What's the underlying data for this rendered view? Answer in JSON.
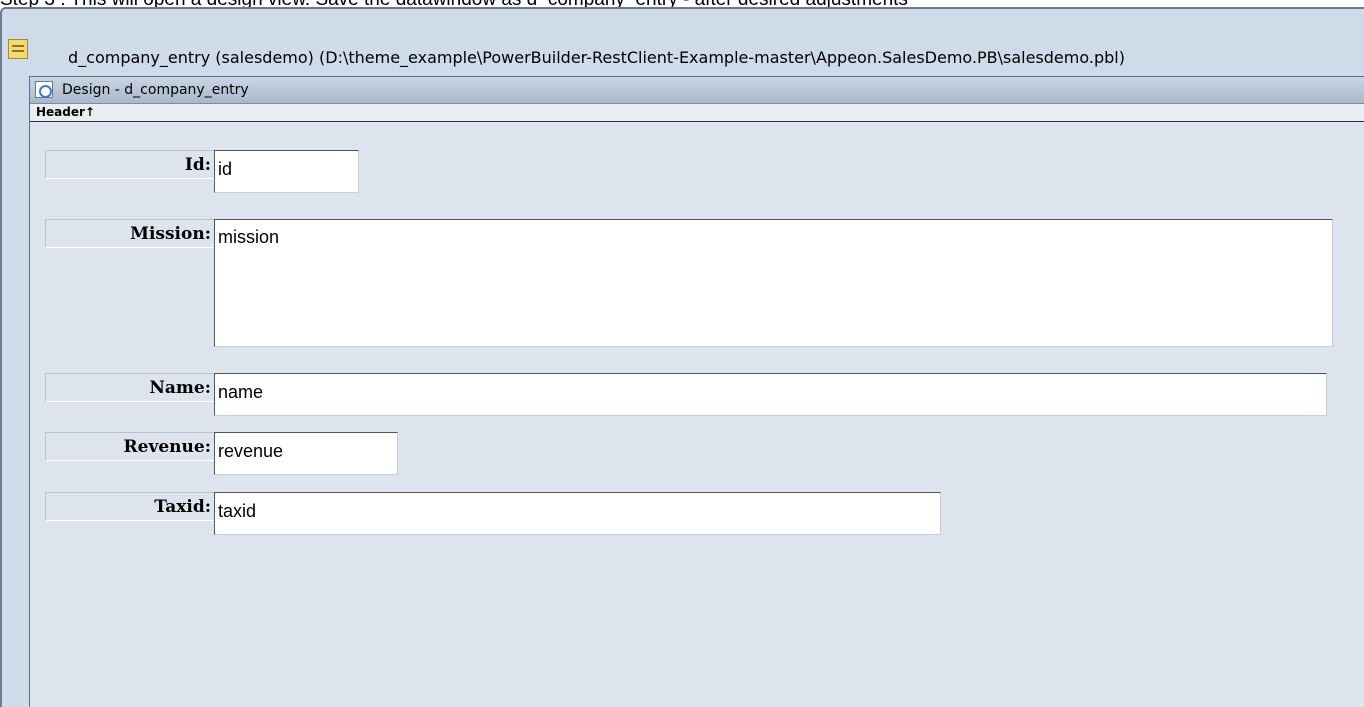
{
  "caption": "Step 3 : This will open a design view. Save the datawindow as d_company_entry - after desired adjustments",
  "window": {
    "title": "d_company_entry  (salesdemo) (D:\\theme_example\\PowerBuilder-RestClient-Example-master\\Appeon.SalesDemo.PB\\salesdemo.pbl)",
    "icon": "datawindow-icon"
  },
  "design_view": {
    "title": "Design - d_company_entry",
    "icon": "design-view-icon",
    "band_label": "Header↑"
  },
  "fields": {
    "id": {
      "label": "Id:",
      "value": "id"
    },
    "mission": {
      "label": "Mission:",
      "value": "mission"
    },
    "name": {
      "label": "Name:",
      "value": "name"
    },
    "revenue": {
      "label": "Revenue:",
      "value": "revenue"
    },
    "taxid": {
      "label": "Taxid:",
      "value": "taxid"
    }
  }
}
